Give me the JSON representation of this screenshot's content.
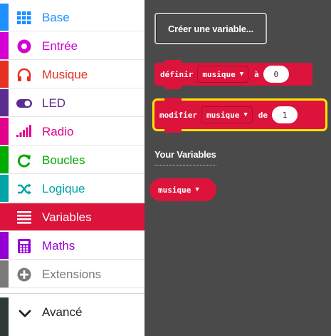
{
  "toolbox": {
    "categories": [
      {
        "label": "Base",
        "icon": "grid-icon",
        "color": "#1e90ff",
        "selected": false
      },
      {
        "label": "Entrée",
        "icon": "input-circle-icon",
        "color": "#d400d4",
        "selected": false
      },
      {
        "label": "Musique",
        "icon": "headphones-icon",
        "color": "#e63022",
        "selected": false
      },
      {
        "label": "LED",
        "icon": "toggle-icon",
        "color": "#5c2d91",
        "selected": false
      },
      {
        "label": "Radio",
        "icon": "signal-bars-icon",
        "color": "#e3008c",
        "selected": false
      },
      {
        "label": "Boucles",
        "icon": "refresh-icon",
        "color": "#00aa00",
        "selected": false
      },
      {
        "label": "Logique",
        "icon": "shuffle-icon",
        "color": "#00a4a6",
        "selected": false
      },
      {
        "label": "Variables",
        "icon": "list-lines-icon",
        "color": "#dc143c",
        "selected": true
      },
      {
        "label": "Maths",
        "icon": "calculator-icon",
        "color": "#9400d3",
        "selected": false
      },
      {
        "label": "Extensions",
        "icon": "plus-circle-icon",
        "color": "#7a7a7a",
        "selected": false
      }
    ],
    "advanced": {
      "label": "Avancé",
      "icon": "chevron-down-icon",
      "color": "#2f3a35"
    }
  },
  "flyout": {
    "create_button": "Créer une variable...",
    "set_block": {
      "keyword": "définir",
      "variable": "musique",
      "connector": "à",
      "value": "0"
    },
    "change_block": {
      "keyword": "modifier",
      "variable": "musique",
      "connector": "de",
      "value": "1"
    },
    "your_variables_heading": "Your Variables",
    "variable_pill": "musique"
  }
}
